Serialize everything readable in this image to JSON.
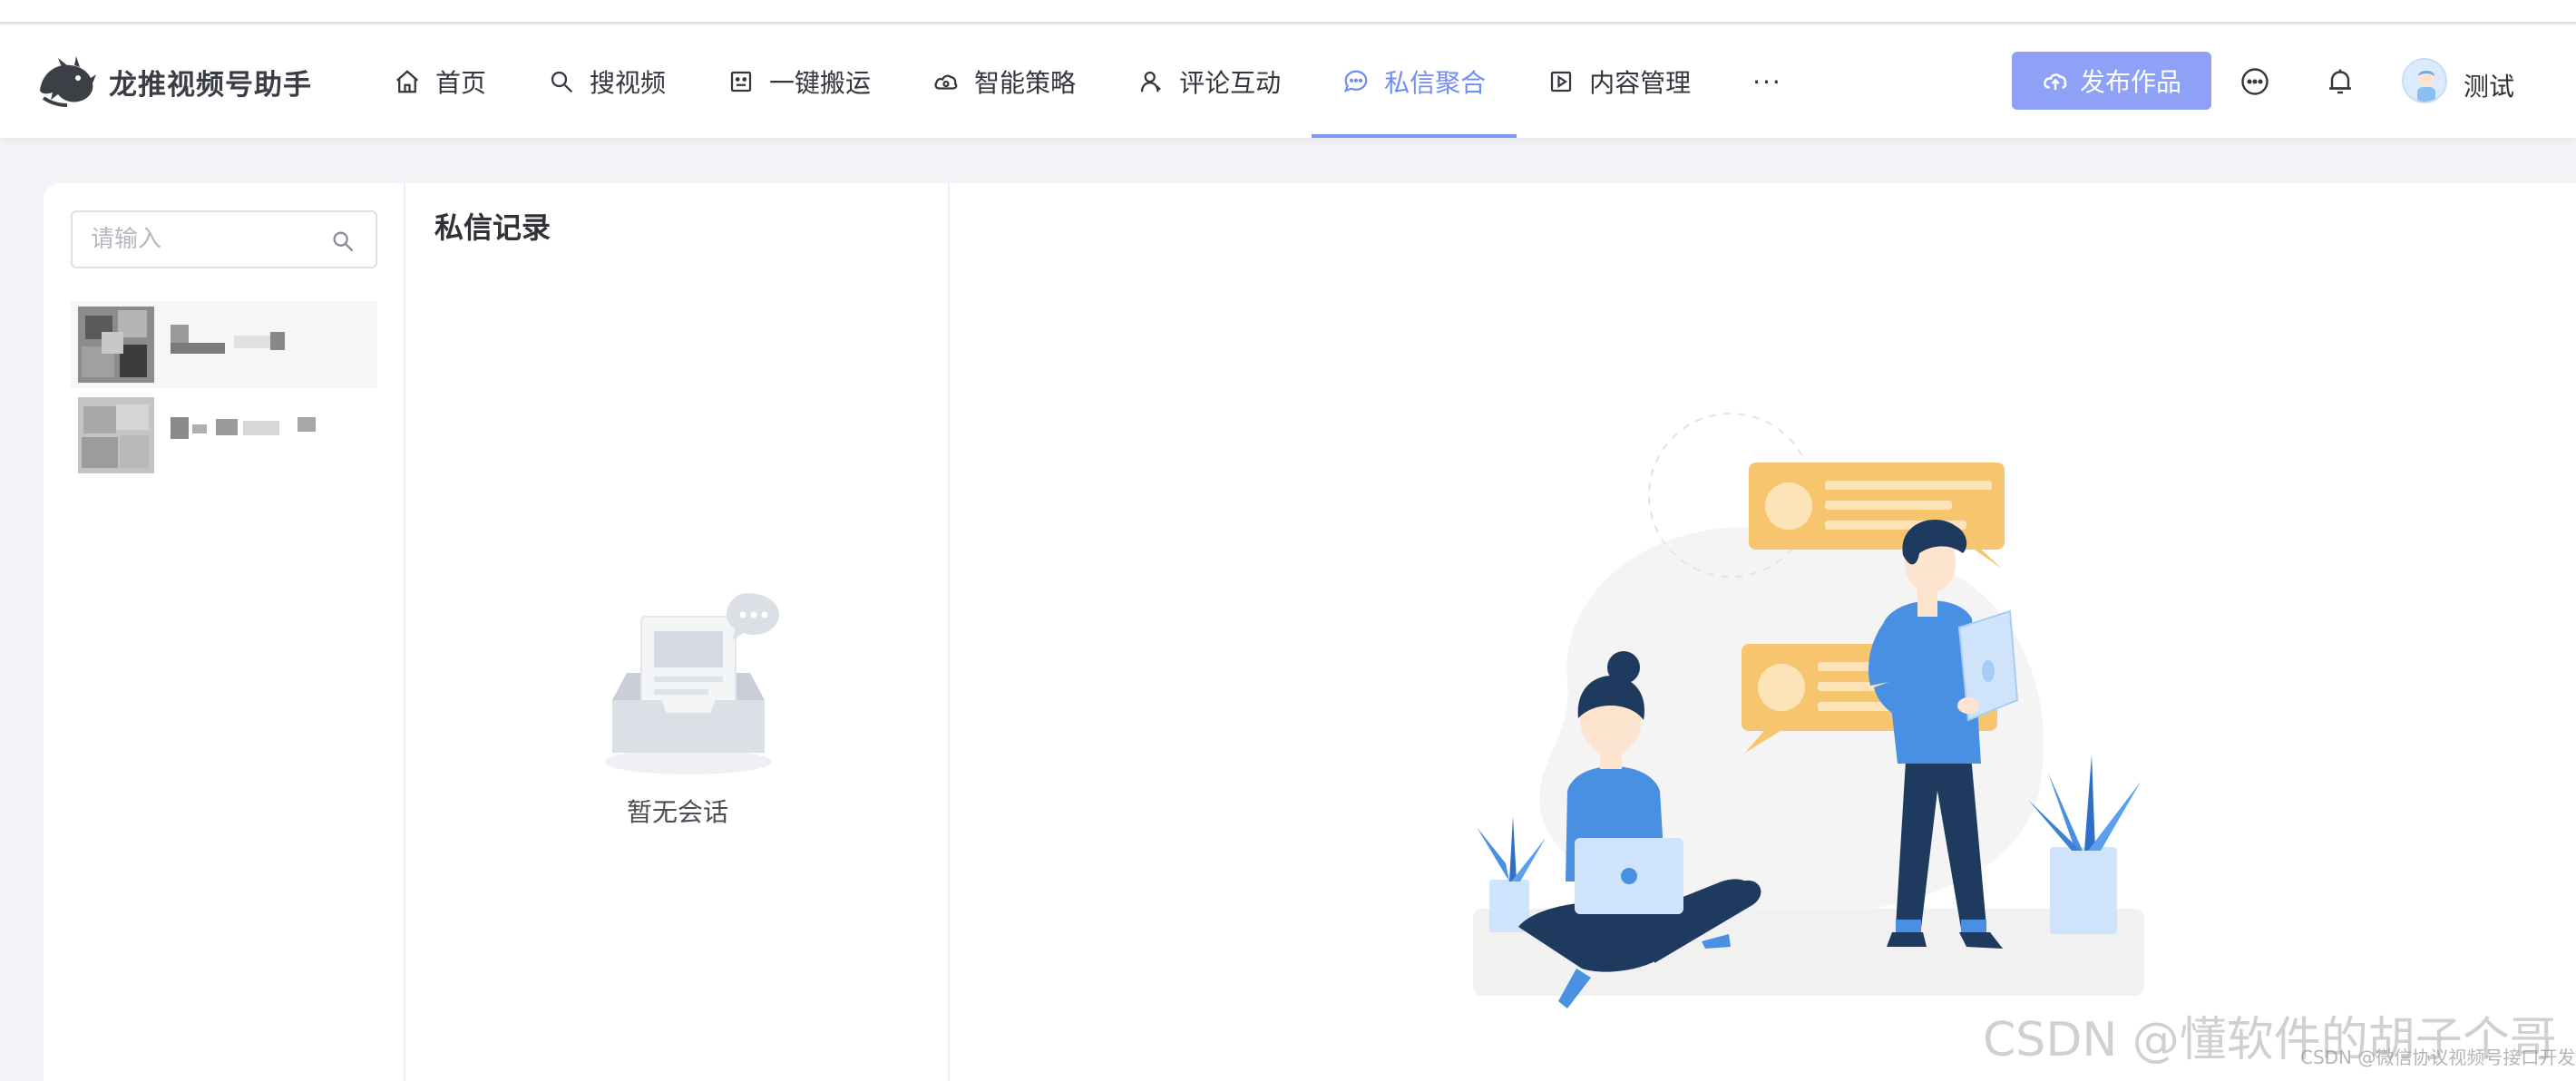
{
  "app": {
    "title": "龙推视频号助手"
  },
  "nav": {
    "items": [
      {
        "label": "首页",
        "icon": "home-icon"
      },
      {
        "label": "搜视频",
        "icon": "search-icon"
      },
      {
        "label": "一键搬运",
        "icon": "robot-icon"
      },
      {
        "label": "智能策略",
        "icon": "cloud-icon"
      },
      {
        "label": "评论互动",
        "icon": "user-icon"
      },
      {
        "label": "私信聚合",
        "icon": "chat-icon",
        "active": true
      },
      {
        "label": "内容管理",
        "icon": "play-icon"
      }
    ],
    "more": "···"
  },
  "header": {
    "publish_label": "发布作品",
    "username": "测试"
  },
  "sidebar": {
    "search_placeholder": "请输入"
  },
  "conversation": {
    "title": "私信记录",
    "empty_text": "暂无会话"
  },
  "colors": {
    "accent": "#7f97f7",
    "publish_bg": "#8ea1f6",
    "bubble": "#f7c56e",
    "figure_blue": "#4a90e2",
    "figure_navy": "#1e3a5f"
  },
  "watermark": {
    "main": "CSDN @懂软件的胡子个哥",
    "sub": "CSDN @微信协议视频号接口开发"
  }
}
